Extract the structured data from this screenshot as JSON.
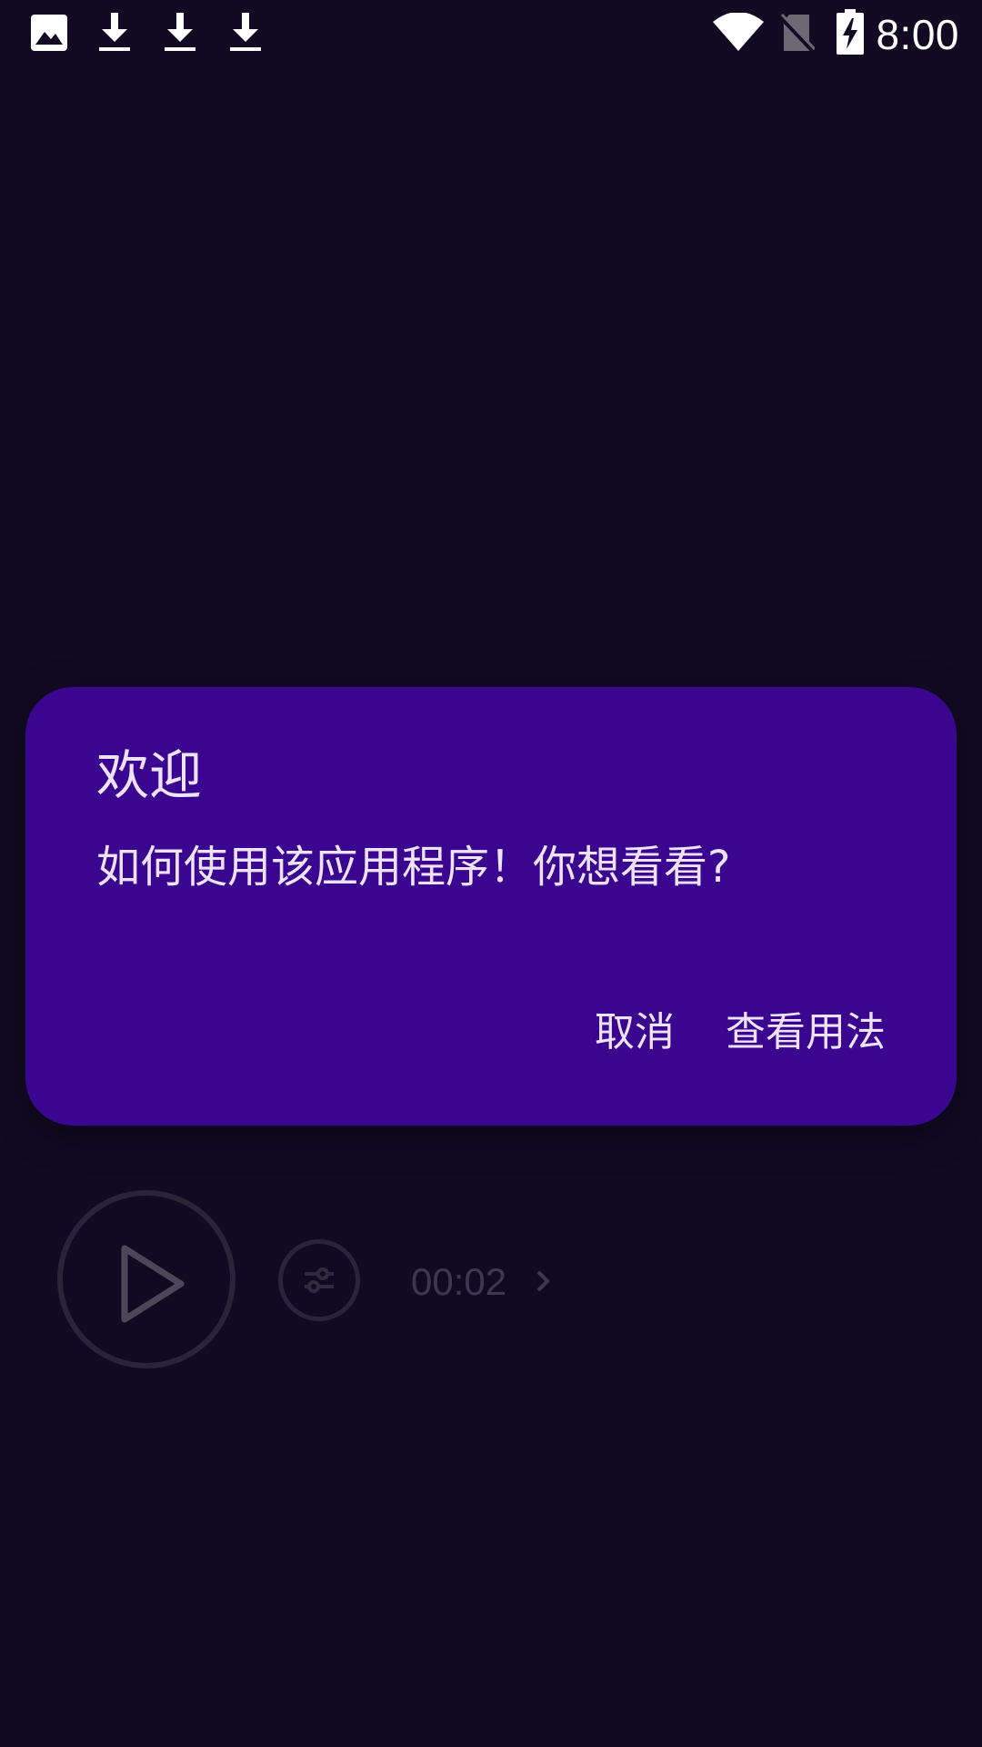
{
  "status_bar": {
    "time": "8:00",
    "left_icons": [
      "image-icon",
      "download-icon",
      "download-icon",
      "download-icon"
    ],
    "right_icons": [
      "wifi-icon",
      "no-sim-icon",
      "battery-charging-icon"
    ]
  },
  "player": {
    "duration": "00:02",
    "icons": [
      "play-icon",
      "equalizer-settings-icon",
      "chevron-right-icon"
    ]
  },
  "dialog": {
    "title": "欢迎",
    "message": "如何使用该应用程序！你想看看?",
    "cancel_label": "取消",
    "confirm_label": "查看用法"
  },
  "colors": {
    "background": "#120a23",
    "dialog_background": "#3a068f",
    "dialog_text": "#ede3ff",
    "dimmed_control": "#2a2438"
  }
}
